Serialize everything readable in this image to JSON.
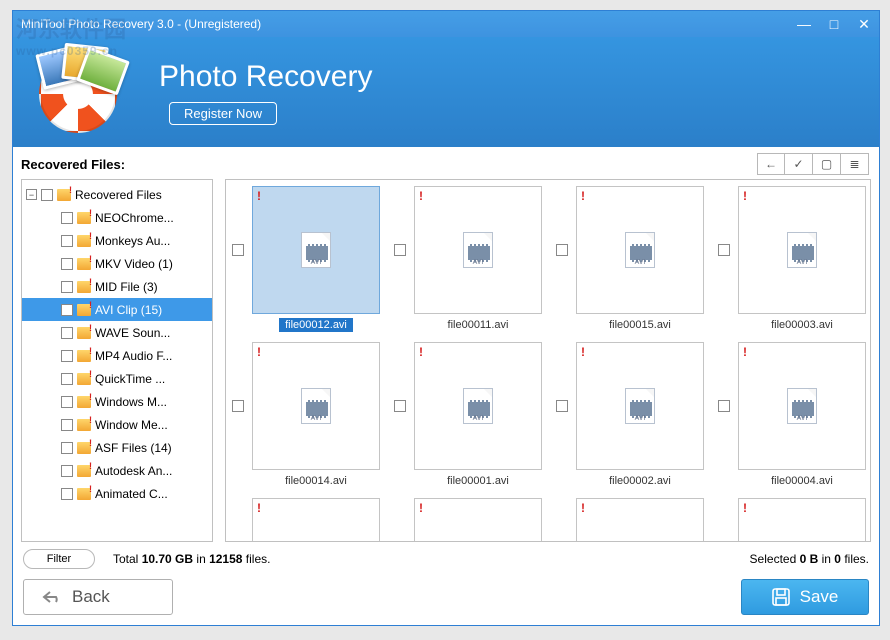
{
  "window": {
    "title": "MiniTool Photo Recovery 3.0 - (Unregistered)"
  },
  "header": {
    "title": "Photo Recovery",
    "register_label": "Register Now"
  },
  "panel_label": "Recovered Files:",
  "toolbar_icons": {
    "back": "←",
    "check": "✓",
    "grid": "▢",
    "list": "≣"
  },
  "tree": {
    "root_label": "Recovered Files",
    "items": [
      {
        "label": "NEOChrome..."
      },
      {
        "label": "Monkeys Au..."
      },
      {
        "label": "MKV Video (1)"
      },
      {
        "label": "MID File (3)"
      },
      {
        "label": "AVI Clip (15)",
        "selected": true
      },
      {
        "label": "WAVE Soun..."
      },
      {
        "label": "MP4 Audio F..."
      },
      {
        "label": "QuickTime ..."
      },
      {
        "label": "Windows M..."
      },
      {
        "label": "Window Me..."
      },
      {
        "label": "ASF Files (14)"
      },
      {
        "label": "Autodesk An..."
      },
      {
        "label": "Animated C..."
      }
    ]
  },
  "files": [
    {
      "name": "file00012.avi",
      "selected": true
    },
    {
      "name": "file00011.avi"
    },
    {
      "name": "file00015.avi"
    },
    {
      "name": "file00003.avi"
    },
    {
      "name": "file00014.avi"
    },
    {
      "name": "file00001.avi"
    },
    {
      "name": "file00002.avi"
    },
    {
      "name": "file00004.avi"
    }
  ],
  "avi_badge": "AVI",
  "status": {
    "filter_label": "Filter",
    "total_prefix": "Total ",
    "total_size": "10.70 GB",
    "total_mid": " in ",
    "total_count": "12158",
    "total_suffix": " files.",
    "sel_prefix": "Selected ",
    "sel_size": "0 B",
    "sel_mid": " in ",
    "sel_count": "0",
    "sel_suffix": " files."
  },
  "footer": {
    "back_label": "Back",
    "save_label": "Save"
  },
  "watermark": {
    "l1": "河东软件园",
    "l2": "www.pc0359.cn"
  }
}
